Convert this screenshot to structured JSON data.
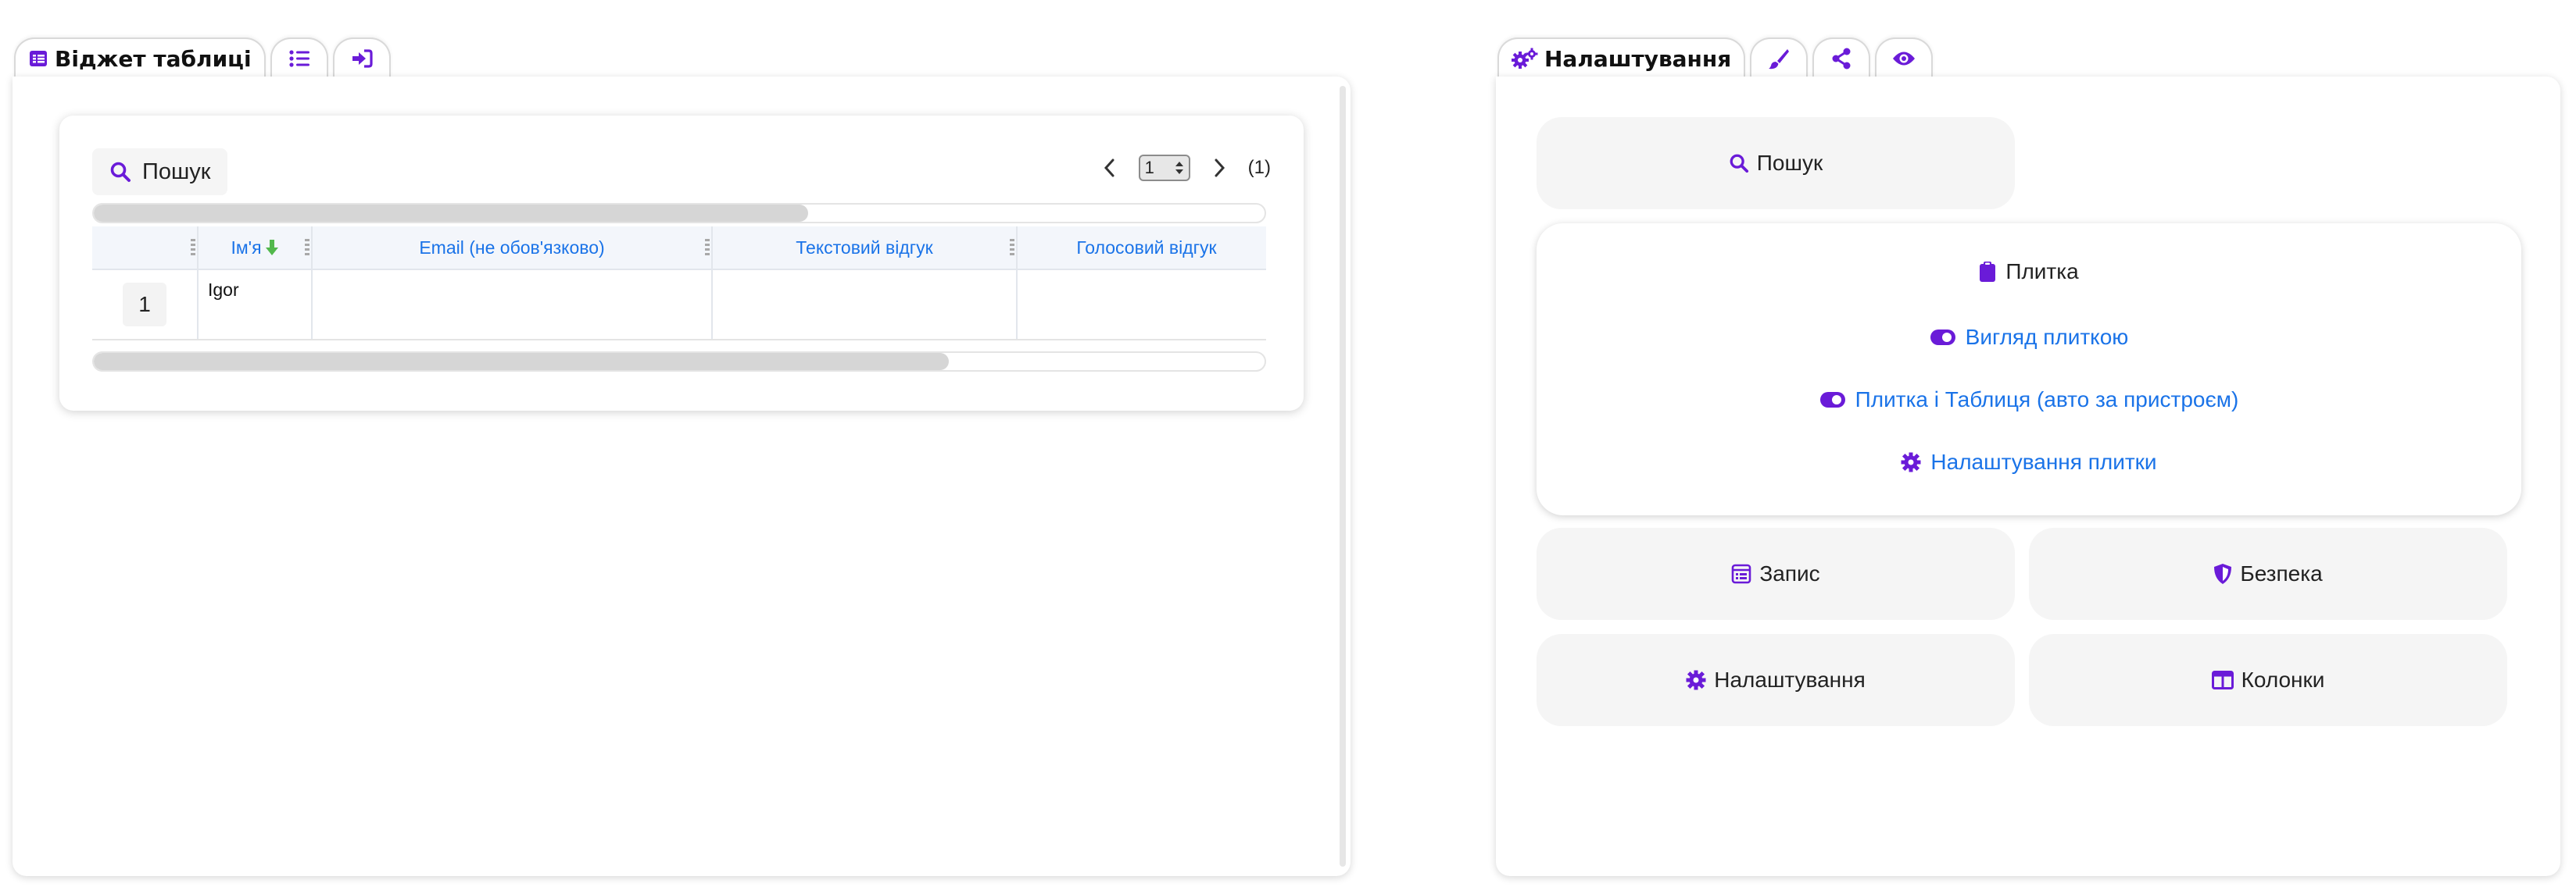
{
  "left_widget": {
    "tabs": [
      {
        "label": "Віджет таблиці",
        "icon": "table-list-icon"
      },
      {
        "label": "",
        "icon": "list-icon"
      },
      {
        "label": "",
        "icon": "sign-in-icon"
      }
    ],
    "table": {
      "search_label": "Пошук",
      "pagination": {
        "current_page": "1",
        "page_count_label": "(1)"
      },
      "columns": [
        "",
        "Ім'я",
        "Email (не обов'язково)",
        "Текстовий відгук",
        "Голосовий відгук"
      ],
      "rows": [
        {
          "index": "1",
          "name": "Igor",
          "email": "",
          "text_feedback": "",
          "voice_feedback": ""
        }
      ],
      "sort": {
        "column": "Ім'я",
        "direction": "descending",
        "icon": "arrow-down-icon"
      },
      "top_scroll_fraction": 0.61,
      "bottom_scroll_fraction": 0.73
    }
  },
  "settings_panel": {
    "tabs": [
      {
        "label": "Налаштування",
        "icon": "gears-icon"
      },
      {
        "label": "",
        "icon": "paintbrush-icon"
      },
      {
        "label": "",
        "icon": "share-icon"
      },
      {
        "label": "",
        "icon": "eye-icon"
      }
    ],
    "search_button": "Пошук",
    "tile_section": {
      "title": "Плитка",
      "tile_view": "Вигляд плиткою",
      "tile_and_table": "Плитка і Таблиця (авто за пристроєм)",
      "tile_settings": "Налаштування плитки"
    },
    "record_button": "Запис",
    "security_button": "Безпека",
    "settings_button": "Налаштування",
    "columns_button": "Колонки"
  },
  "colors": {
    "accent_purple": "#6a1bd8",
    "link_blue": "#1a73e8",
    "sort_green": "#52b84c",
    "button_bg": "#f5f5f5"
  }
}
